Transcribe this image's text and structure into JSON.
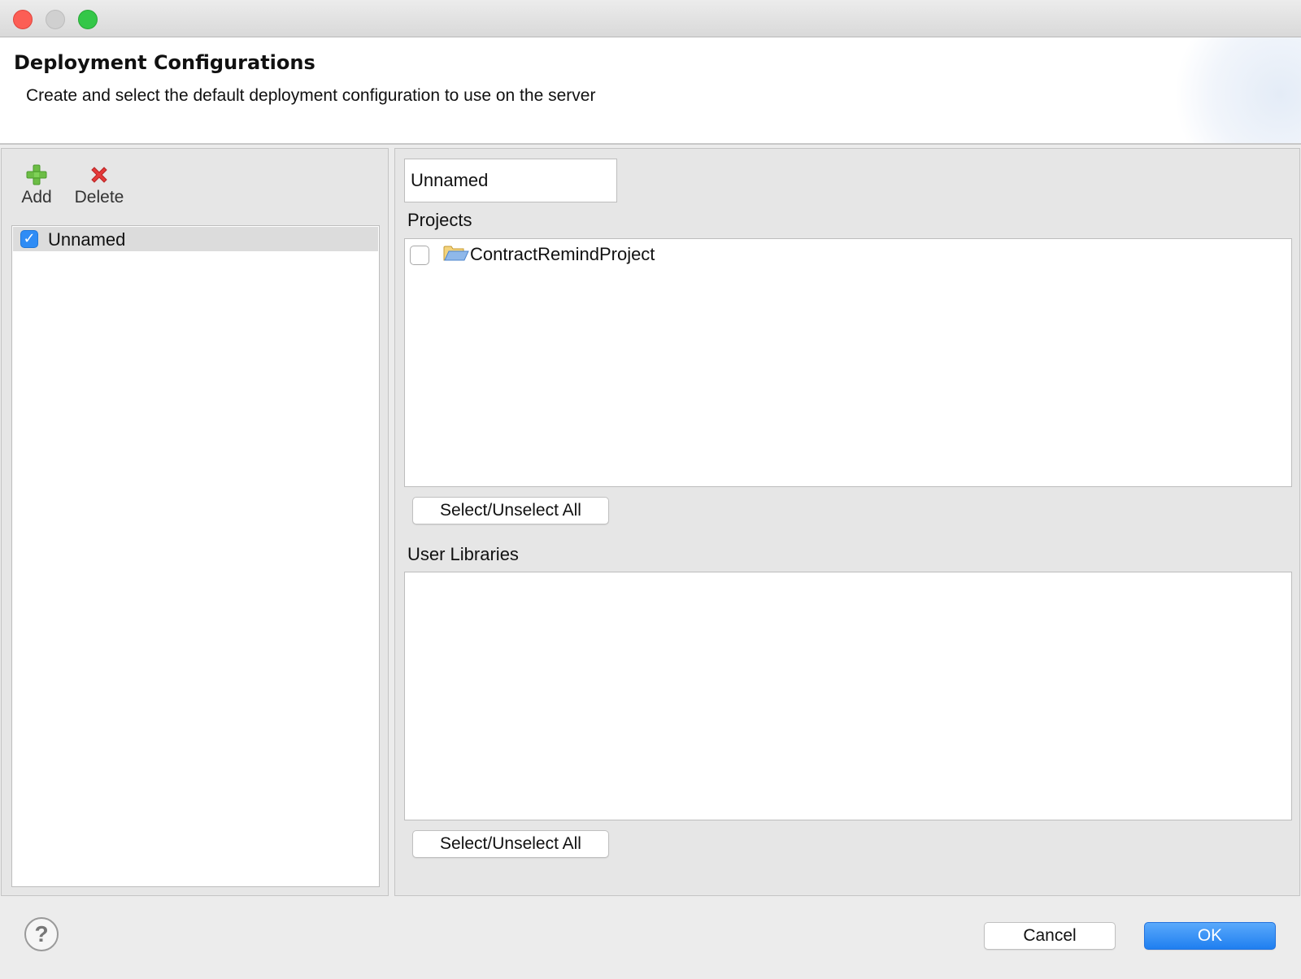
{
  "dialog": {
    "title": "Deployment Configurations",
    "description": "Create and select the default deployment configuration to use on the server"
  },
  "toolbar": {
    "add_label": "Add",
    "add_icon": "plus-icon",
    "delete_label": "Delete",
    "delete_icon": "x-delete-icon"
  },
  "configurations": [
    {
      "label": "Unnamed",
      "checked": true,
      "selected": true
    }
  ],
  "detail": {
    "name_value": "Unnamed",
    "projects_label": "Projects",
    "projects": [
      {
        "label": "ContractRemindProject",
        "checked": false,
        "icon": "folder-icon"
      }
    ],
    "projects_select_all": "Select/Unselect All",
    "user_libraries_label": "User Libraries",
    "user_libraries": [],
    "libraries_select_all": "Select/Unselect All"
  },
  "footer": {
    "help_icon": "help-icon",
    "cancel_label": "Cancel",
    "ok_label": "OK"
  },
  "colors": {
    "accent": "#1f7ff0",
    "checkbox": "#2f8cf5",
    "close": "#fc5e55",
    "maximize": "#34c748"
  }
}
